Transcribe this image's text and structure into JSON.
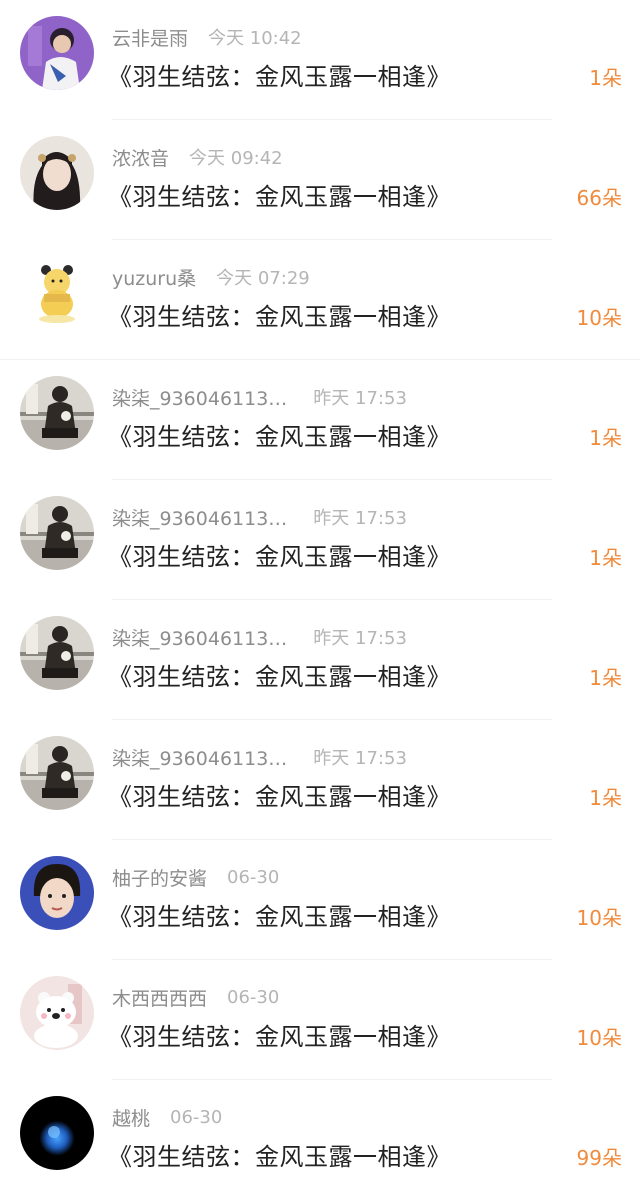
{
  "rows": [
    {
      "username": "云非是雨",
      "time": "今天 10:42",
      "title": "《羽生结弦：金风玉露一相逢》",
      "count": "1朵",
      "avatar_icon": "figure-skater-avatar-icon",
      "time_gap": 20
    },
    {
      "username": "浓浓音",
      "time": "今天 09:42",
      "title": "《羽生结弦：金风玉露一相逢》",
      "count": "66朵",
      "avatar_icon": "woman-portrait-avatar-icon",
      "time_gap": 20
    },
    {
      "username": "yuzuru桑",
      "time": "今天 07:29",
      "title": "《羽生结弦：金风玉露一相逢》",
      "count": "10朵",
      "avatar_icon": "pooh-bear-avatar-icon",
      "time_gap": 20
    },
    {
      "username": "染柒_936046113…",
      "time": "昨天 17:53",
      "title": "《羽生结弦：金风玉露一相逢》",
      "count": "1朵",
      "avatar_icon": "kneeling-person-avatar-icon",
      "time_gap": 26
    },
    {
      "username": "染柒_936046113…",
      "time": "昨天 17:53",
      "title": "《羽生结弦：金风玉露一相逢》",
      "count": "1朵",
      "avatar_icon": "kneeling-person-avatar-icon",
      "time_gap": 26
    },
    {
      "username": "染柒_936046113…",
      "time": "昨天 17:53",
      "title": "《羽生结弦：金风玉露一相逢》",
      "count": "1朵",
      "avatar_icon": "kneeling-person-avatar-icon",
      "time_gap": 26
    },
    {
      "username": "染柒_936046113…",
      "time": "昨天 17:53",
      "title": "《羽生结弦：金风玉露一相逢》",
      "count": "1朵",
      "avatar_icon": "kneeling-person-avatar-icon",
      "time_gap": 26
    },
    {
      "username": "柚子的安酱",
      "time": "06-30",
      "title": "《羽生结弦：金风玉露一相逢》",
      "count": "10朵",
      "avatar_icon": "boy-portrait-avatar-icon",
      "time_gap": 20
    },
    {
      "username": "木西西西西",
      "time": "06-30",
      "title": "《羽生结弦：金风玉露一相逢》",
      "count": "10朵",
      "avatar_icon": "white-bear-avatar-icon",
      "time_gap": 20
    },
    {
      "username": "越桃",
      "time": "06-30",
      "title": "《羽生结弦：金风玉露一相逢》",
      "count": "99朵",
      "avatar_icon": "blue-glow-avatar-icon",
      "time_gap": 20
    }
  ],
  "colors": {
    "count": "#f08a3c",
    "username": "#8d8d8d",
    "time": "#b5b5b5",
    "title": "#222222",
    "divider": "#f1f1f1"
  }
}
